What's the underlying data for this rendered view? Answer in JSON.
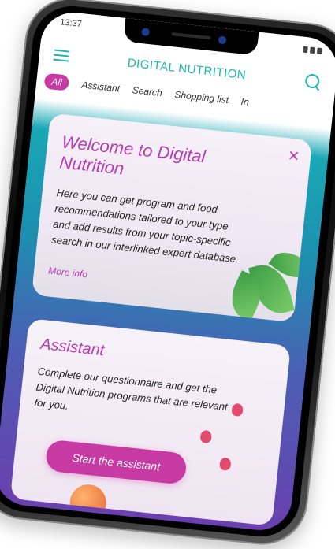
{
  "status_bar": {
    "time": "13:37"
  },
  "header": {
    "title": "DIGITAL NUTRITION"
  },
  "tabs": [
    {
      "label": "All",
      "active": true
    },
    {
      "label": "Assistant"
    },
    {
      "label": "Search"
    },
    {
      "label": "Shopping list"
    },
    {
      "label": "In"
    }
  ],
  "welcome_card": {
    "title": "Welcome to Digital Nutrition",
    "body": "Here you can get program and food recommendations tailored to your type and add results from your topic-specific search in our interlinked expert database.",
    "link": "More info"
  },
  "assistant_card": {
    "title": "Assistant",
    "body": "Complete our questionnaire and get the Digital Nutrition programs that are relevant for you.",
    "button": "Start the assistant"
  },
  "colors": {
    "accent_teal": "#1fb5b0",
    "accent_magenta": "#c73aa4"
  }
}
